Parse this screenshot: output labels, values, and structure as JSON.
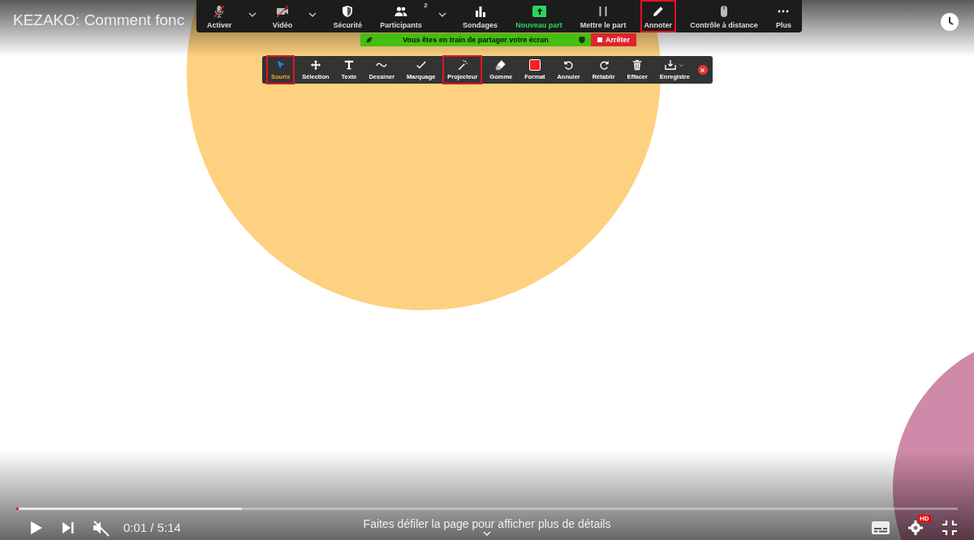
{
  "video_title": "KEZAKO: Comment fonc",
  "meeting_toolbar": {
    "items": [
      {
        "kind": "button",
        "label": "Activer",
        "muted": true,
        "highlighted": false,
        "accent": false
      },
      {
        "kind": "caret"
      },
      {
        "kind": "button",
        "label": "Vidéo",
        "muted": true,
        "highlighted": false,
        "accent": false
      },
      {
        "kind": "caret"
      },
      {
        "kind": "button",
        "label": "Sécurité",
        "highlighted": false,
        "accent": false
      },
      {
        "kind": "button",
        "label": "Participants",
        "badge": "2",
        "highlighted": false,
        "accent": false
      },
      {
        "kind": "caret"
      },
      {
        "kind": "button",
        "label": "Sondages",
        "highlighted": false,
        "accent": false
      },
      {
        "kind": "button",
        "label": "Nouveau part",
        "highlighted": false,
        "accent": true
      },
      {
        "kind": "button",
        "label": "Mettre le part",
        "highlighted": false,
        "accent": false
      },
      {
        "kind": "button",
        "label": "Annoter",
        "highlighted": true,
        "accent": false
      },
      {
        "kind": "button",
        "label": "Contrôle à distance",
        "highlighted": false,
        "accent": false
      },
      {
        "kind": "button",
        "label": "Plus",
        "highlighted": false,
        "accent": false
      }
    ]
  },
  "sharing_banner": {
    "text": "Vous êtes en train de partager votre écran",
    "stop_label": "Arrêter"
  },
  "annotation_toolbar": {
    "items": [
      {
        "kind": "tool",
        "label": "Souris",
        "selected": true,
        "highlighted": true
      },
      {
        "kind": "tool",
        "label": "Sélection",
        "selected": false,
        "highlighted": false
      },
      {
        "kind": "tool",
        "label": "Texte",
        "selected": false,
        "highlighted": false
      },
      {
        "kind": "tool",
        "label": "Dessiner",
        "selected": false,
        "highlighted": false
      },
      {
        "kind": "tool",
        "label": "Marquage",
        "selected": false,
        "highlighted": false
      },
      {
        "kind": "tool",
        "label": "Projecteur",
        "selected": false,
        "highlighted": true
      },
      {
        "kind": "tool",
        "label": "Gomme",
        "selected": false,
        "highlighted": false
      },
      {
        "kind": "swatch",
        "label": "Format",
        "color": "#ff1f1f",
        "selected": false,
        "highlighted": false
      },
      {
        "kind": "tool",
        "label": "Annuler",
        "selected": false,
        "highlighted": false
      },
      {
        "kind": "tool",
        "label": "Rétablir",
        "selected": false,
        "highlighted": false
      },
      {
        "kind": "tool",
        "label": "Effacer",
        "selected": false,
        "highlighted": false
      },
      {
        "kind": "dropdown",
        "label": "Enregistre",
        "selected": false,
        "highlighted": false
      },
      {
        "kind": "close"
      }
    ]
  },
  "player": {
    "progress": {
      "level": 0.003,
      "buffered": {
        "level": 0.24
      }
    },
    "muted": true,
    "time": "0:01 / 5:14",
    "scroll_hint": "Faites défiler la page pour afficher plus de détails",
    "hd_badge": "HD"
  }
}
